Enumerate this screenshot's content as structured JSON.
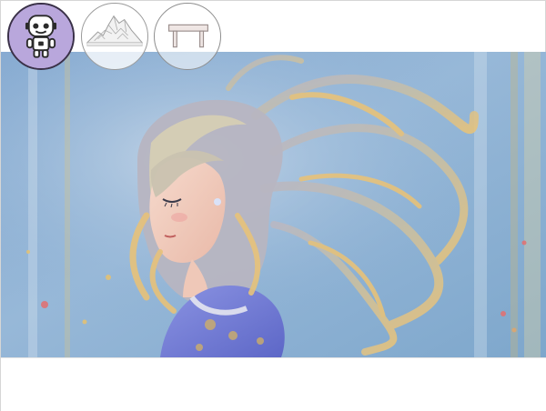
{
  "toolbar": {
    "avatars": [
      {
        "icon": "robot-avatar-icon",
        "selected": true,
        "background": "#b9a7dc"
      },
      {
        "icon": "mountain-sketch-icon",
        "selected": false
      },
      {
        "icon": "table-icon",
        "selected": false
      }
    ]
  },
  "scene": {
    "subject": "anime-girl-illustration",
    "palette": {
      "background": "#8fb1d6",
      "hair": "#e7c27a",
      "hair_shadow": "#a7a4b6",
      "skin": "#f0cdbd",
      "shirt": "#6f7ad6"
    }
  }
}
